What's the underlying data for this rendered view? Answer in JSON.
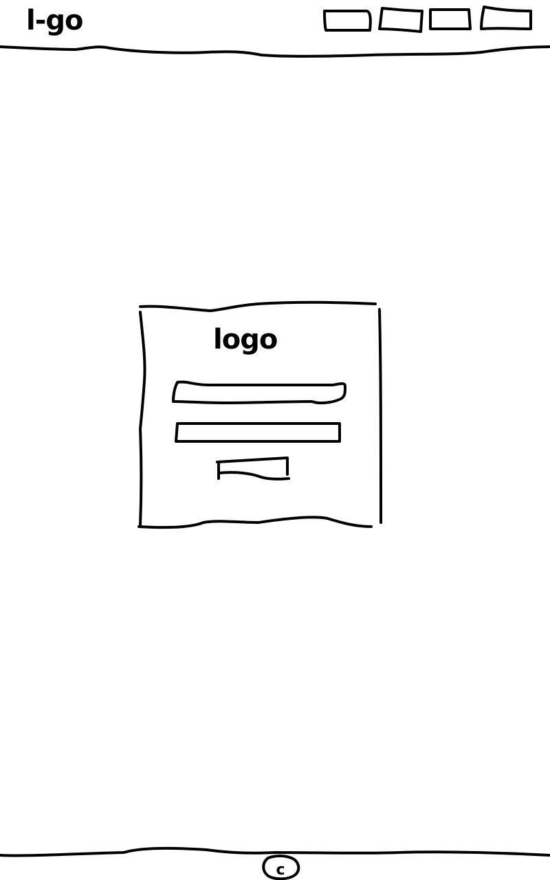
{
  "header": {
    "logo_text": "l-go",
    "nav_items": [
      "",
      "",
      "",
      ""
    ]
  },
  "login_card": {
    "logo_text": "logo",
    "username_value": "",
    "password_value": "",
    "submit_label": ""
  },
  "footer": {
    "copyright_symbol": "c"
  },
  "colors": {
    "stroke": "#000000",
    "background": "#ffffff"
  }
}
